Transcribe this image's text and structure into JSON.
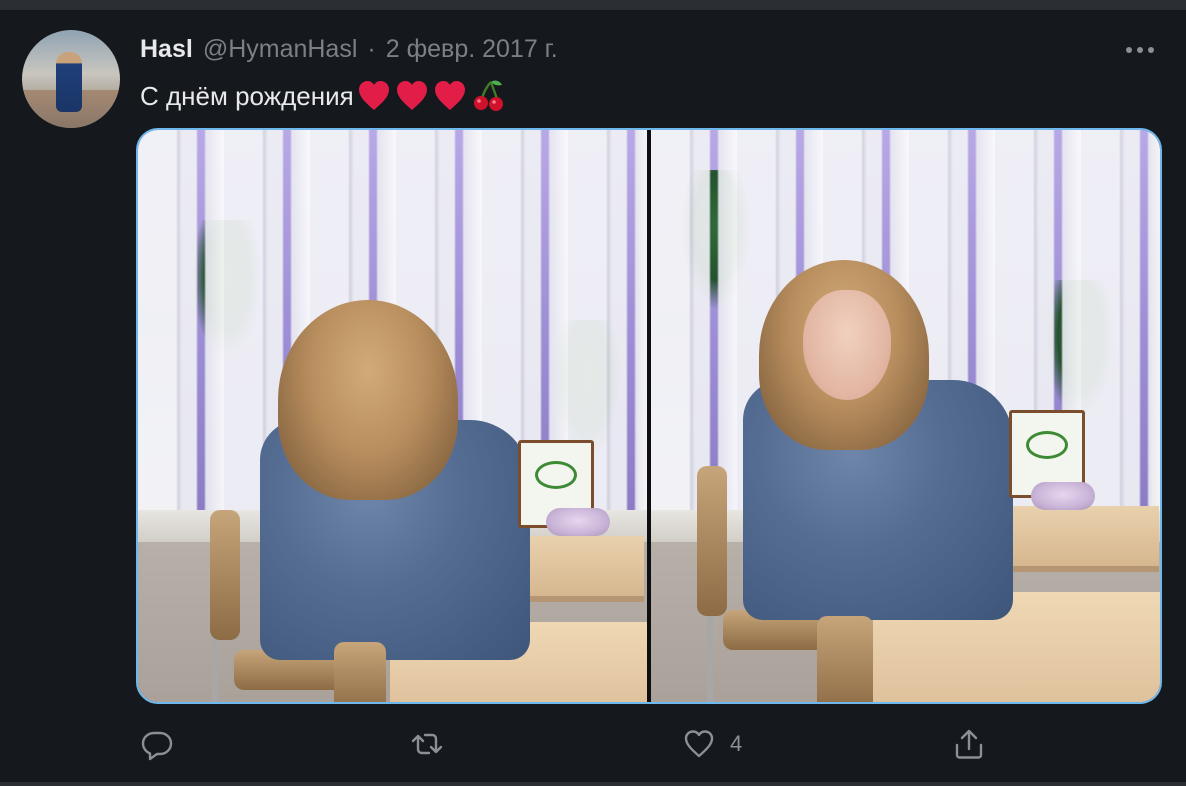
{
  "tweet": {
    "author": {
      "display_name": "Hasl",
      "handle": "@HymanHasl",
      "separator": "·",
      "date": "2 февр. 2017 г."
    },
    "text": "С днём рождения",
    "emojis": [
      "heart",
      "heart",
      "heart",
      "cherries"
    ],
    "media": {
      "photo_count": 2,
      "border_color": "#6fb8ee"
    },
    "actions": {
      "reply": {
        "icon": "reply-icon",
        "count": ""
      },
      "retweet": {
        "icon": "retweet-icon",
        "count": ""
      },
      "like": {
        "icon": "heart-outline-icon",
        "count": "4"
      },
      "share": {
        "icon": "share-icon",
        "count": ""
      }
    },
    "menu": {
      "icon": "more-options-icon"
    }
  },
  "theme": {
    "background": "#15181c",
    "text_primary": "#e7e9ea",
    "text_secondary": "#7b8086",
    "heart_red": "#e11d48",
    "accent_blue": "#1d9bf0"
  }
}
